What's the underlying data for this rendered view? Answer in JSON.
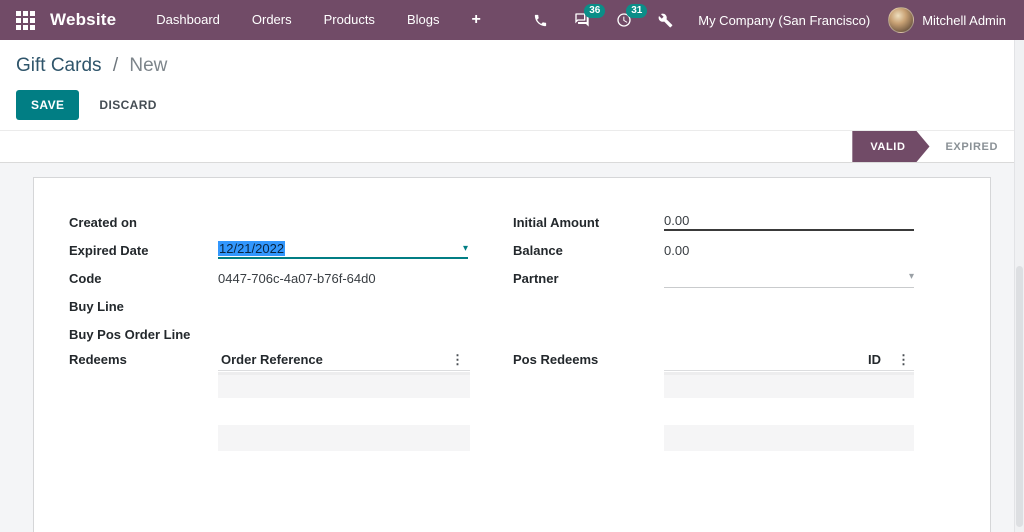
{
  "navbar": {
    "brand": "Website",
    "menus": [
      "Dashboard",
      "Orders",
      "Products",
      "Blogs"
    ],
    "badges": {
      "messages": "36",
      "activities": "31"
    },
    "company": "My Company (San Francisco)",
    "user": "Mitchell Admin"
  },
  "breadcrumb": {
    "parent": "Gift Cards",
    "separator": "/",
    "current": "New"
  },
  "actions": {
    "save": "SAVE",
    "discard": "DISCARD"
  },
  "statusbar": {
    "active": "VALID",
    "inactive": "EXPIRED"
  },
  "form": {
    "left": {
      "created_on": {
        "label": "Created on",
        "value": ""
      },
      "expired_date": {
        "label": "Expired Date",
        "value": "12/21/2022"
      },
      "code": {
        "label": "Code",
        "value": "0447-706c-4a07-b76f-64d0"
      },
      "buy_line": {
        "label": "Buy Line",
        "value": ""
      },
      "buy_pos_order_line": {
        "label": "Buy Pos Order Line",
        "value": ""
      },
      "redeems": {
        "label": "Redeems",
        "column": "Order Reference"
      }
    },
    "right": {
      "initial_amount": {
        "label": "Initial Amount",
        "value": "0.00"
      },
      "balance": {
        "label": "Balance",
        "value": "0.00"
      },
      "partner": {
        "label": "Partner",
        "value": ""
      },
      "pos_redeems": {
        "label": "Pos Redeems",
        "column": "ID"
      }
    }
  },
  "icons": {
    "plus": "+",
    "kebab": "⋮",
    "caret": "▾"
  },
  "colors": {
    "navbar": "#714B67",
    "primary_button": "#017e84",
    "badge": "#0b8e88",
    "selection": "#3297fd",
    "status_active": "#714B67"
  }
}
